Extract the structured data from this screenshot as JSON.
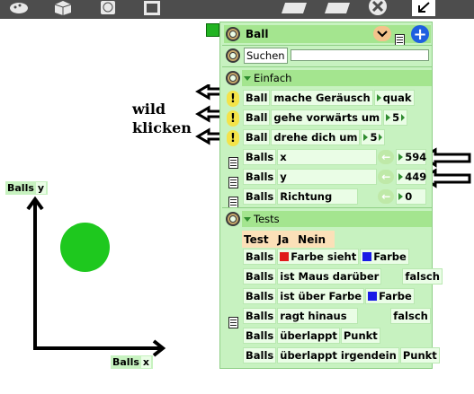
{
  "panel": {
    "title": "Ball",
    "search_button": "Suchen",
    "search_placeholder": "",
    "section_simple": "Einfach",
    "section_tests": "Tests"
  },
  "commands": [
    {
      "target": "Ball",
      "words": "mache Geräusch",
      "value": "quak"
    },
    {
      "target": "Ball",
      "words": "gehe vorwärts um",
      "value": "5"
    },
    {
      "target": "Ball",
      "words": "drehe dich um",
      "value": "5"
    }
  ],
  "properties": [
    {
      "target": "Balls",
      "name": "x",
      "value": "594"
    },
    {
      "target": "Balls",
      "name": "y",
      "value": "449"
    },
    {
      "target": "Balls",
      "name": "Richtung",
      "value": "0"
    }
  ],
  "tests": {
    "header": [
      "Test",
      "Ja",
      "Nein"
    ],
    "rows": [
      {
        "target": "Balls",
        "words": "Farbe sieht",
        "color": "#e01b1b",
        "words2": "Farbe",
        "color2": "#1a1ae6",
        "result": ""
      },
      {
        "target": "Balls",
        "words": "ist Maus darüber",
        "result": "falsch"
      },
      {
        "target": "Balls",
        "words": "ist über Farbe",
        "color": "#1a1ae6",
        "words2": "Farbe",
        "result": ""
      },
      {
        "target": "Balls",
        "words": "ragt hinaus",
        "result": "falsch"
      },
      {
        "target": "Balls",
        "words": "überlappt",
        "words2": "Punkt",
        "result": ""
      },
      {
        "target": "Balls",
        "words": "überlappt irgendein",
        "words2": "Punkt",
        "result": ""
      }
    ]
  },
  "annotation": {
    "line1": "wild",
    "line2": "klicken"
  },
  "axes": {
    "y_label_target": "Balls",
    "y_label_name": "y",
    "x_label_target": "Balls",
    "x_label_name": "x"
  },
  "colors": {
    "ball": "#1ec81e",
    "panel": "#c7f2c0",
    "topbar": "#4d4d4d"
  },
  "icons": [
    "paint-icon",
    "cube-icon",
    "globe-icon",
    "fullscreen-icon",
    "trash-icon",
    "tray-icon",
    "close-icon",
    "shrink-icon",
    "gear-icon",
    "menu-icon",
    "plus-icon",
    "left-arrow-icon",
    "doc-icon",
    "exclamation-icon"
  ]
}
